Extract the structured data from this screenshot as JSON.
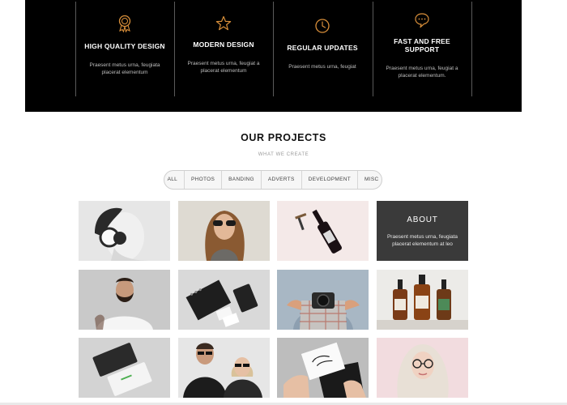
{
  "features": [
    {
      "title": "HIGH QUALITY DESIGN",
      "desc": "Praesent metus urna, feugiata placerat elementum",
      "icon": "award-icon"
    },
    {
      "title": "MODERN DESIGN",
      "desc": "Praesent metus urna, feugiat a placerat elementum",
      "icon": "star-icon"
    },
    {
      "title": "REGULAR UPDATES",
      "desc": "Praesent metus urna, feugiat",
      "icon": "clock-icon"
    },
    {
      "title": "FAST AND FREE SUPPORT",
      "desc": "Praesent metus urna, feugiat a placerat elementum.",
      "icon": "chat-bubble-icon"
    }
  ],
  "projects": {
    "title": "OUR PROJECTS",
    "subtitle": "WHAT WE CREATE",
    "filters": [
      "ALL",
      "PHOTOS",
      "BANDING",
      "ADVERTS",
      "DEVELOPMENT",
      "MISC"
    ]
  },
  "about": {
    "title": "ABOUT",
    "text": "Praesent metus urna, feugiata placerat elementum at leo"
  },
  "colors": {
    "accent": "#d98f3a",
    "feature_bg": "#000000",
    "about_bg": "#3a3a3a"
  }
}
